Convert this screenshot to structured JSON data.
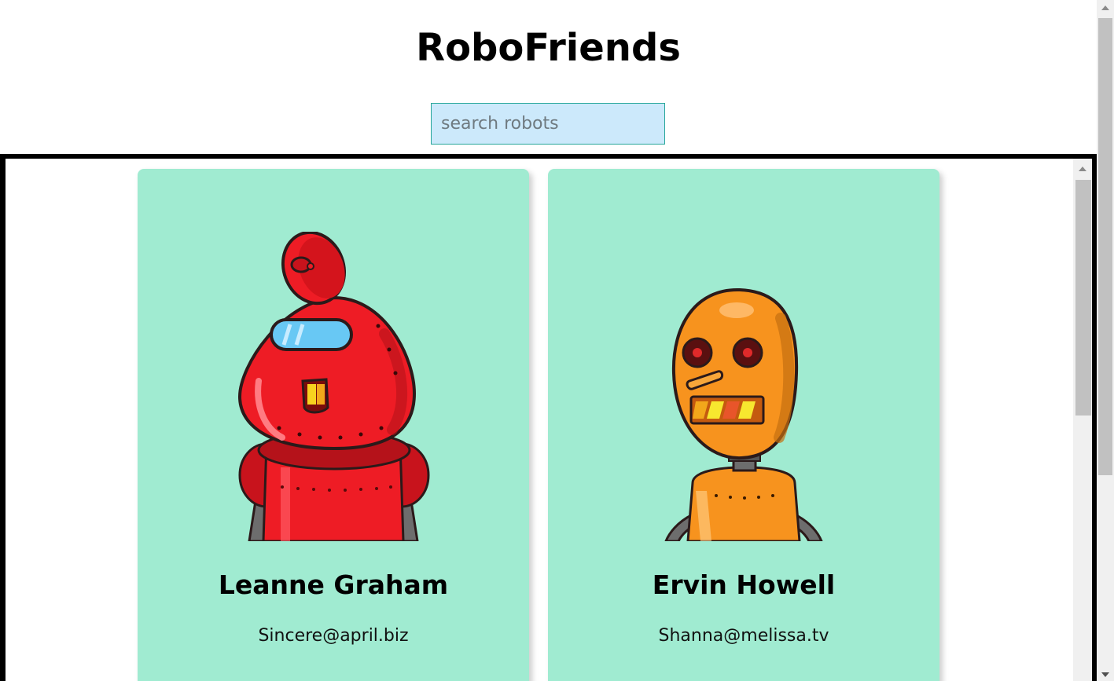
{
  "app": {
    "title": "RoboFriends"
  },
  "search": {
    "placeholder": "search robots",
    "value": ""
  },
  "robots": [
    {
      "name": "Leanne Graham",
      "email": "Sincere@april.biz",
      "avatar_icon": "red-robot-avatar",
      "color": "#ee1c25"
    },
    {
      "name": "Ervin Howell",
      "email": "Shanna@melissa.tv",
      "avatar_icon": "orange-robot-avatar",
      "color": "#f7931e"
    }
  ],
  "colors": {
    "card_background": "#a0ebd1",
    "search_background": "#cce9fb",
    "search_border": "#26a69a"
  }
}
